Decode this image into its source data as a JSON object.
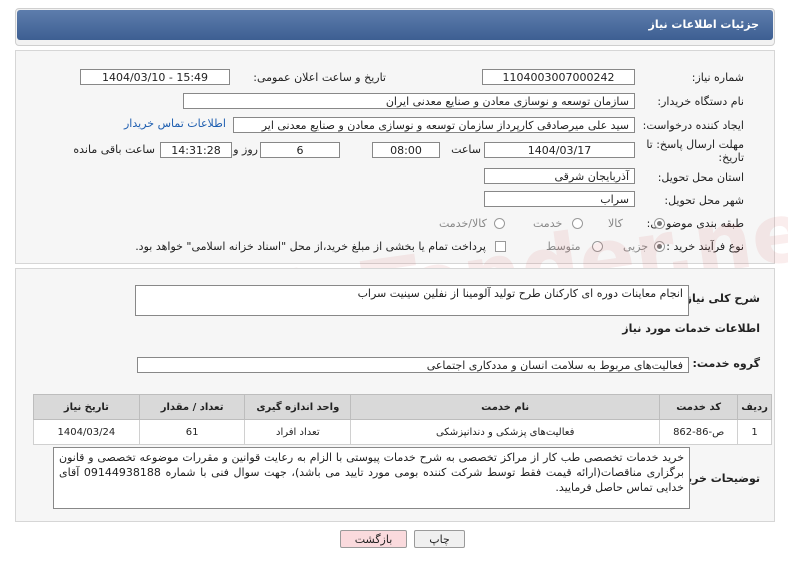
{
  "header": {
    "title": "جزئیات اطلاعات نیاز"
  },
  "form": {
    "need_number_label": "شماره نیاز:",
    "need_number": "1104003007000242",
    "announce_label": "تاریخ و ساعت اعلان عمومی:",
    "announce_value": "1404/03/10 - 15:49",
    "buyer_org_label": "نام دستگاه خریدار:",
    "buyer_org": "سازمان توسعه و نوسازی معادن و صنایع معدنی ایران",
    "requester_label": "ایجاد کننده درخواست:",
    "requester": "سید علی میرصادقی کارپرداز سازمان توسعه و نوسازی معادن و صنایع معدنی ایر",
    "buyer_contact_link": "اطلاعات تماس خریدار",
    "deadline_label_1": "مهلت ارسال پاسخ: تا",
    "deadline_label_2": "تاریخ:",
    "deadline_date": "1404/03/17",
    "time_label": "ساعت",
    "deadline_time": "08:00",
    "days_value": "6",
    "days_label": "روز و",
    "remaining_time": "14:31:28",
    "remaining_label": "ساعت باقی مانده",
    "province_label": "استان محل تحویل:",
    "province": "آذربایجان شرقی",
    "city_label": "شهر محل تحویل:",
    "city": "سراب",
    "category_label": "طبقه بندی موضوعی:",
    "category_options": [
      "کالا",
      "خدمت",
      "کالا/خدمت"
    ],
    "purchase_type_label": "نوع فرآیند خرید :",
    "purchase_options": [
      "جزیی",
      "متوسط"
    ],
    "payment_note": "پرداخت تمام یا بخشی از مبلغ خرید،از محل \"اسناد خزانه اسلامی\" خواهد بود."
  },
  "details": {
    "summary_label": "شرح کلی نیاز:",
    "summary": "انجام معاینات دوره ای کارکنان طرح تولید آلومینا از نفلین سینیت سراب",
    "services_heading": "اطلاعات خدمات مورد نیاز",
    "service_group_label": "گروه خدمت:",
    "service_group": "فعالیت‌های مربوط به سلامت انسان و مددکاری اجتماعی",
    "table_headers": [
      "ردیف",
      "کد خدمت",
      "نام خدمت",
      "واحد اندازه گیری",
      "تعداد / مقدار",
      "تاریخ نیاز"
    ],
    "rows": [
      [
        "1",
        "ص-86-862",
        "فعالیت‌های پزشکی و دندانپزشکی",
        "تعداد افراد",
        "61",
        "1404/03/24"
      ]
    ],
    "buyer_notes_label": "توضیحات خریدار:",
    "buyer_notes": "خرید خدمات تخصصی طب کار از مراکز تخصصی به شرح خدمات پیوستی با الزام به رعایت قوانین و مقررات موضوعه تخصصی و قانون برگزاری مناقصات(ارائه قیمت فقط توسط شرکت کننده بومی مورد تایید می باشد)، جهت سوال فنی با شماره 09144938188 آقای خدایی تماس حاصل فرمایید."
  },
  "buttons": {
    "print": "چاپ",
    "back": "بازگشت"
  },
  "watermark": "AriaTender.net"
}
